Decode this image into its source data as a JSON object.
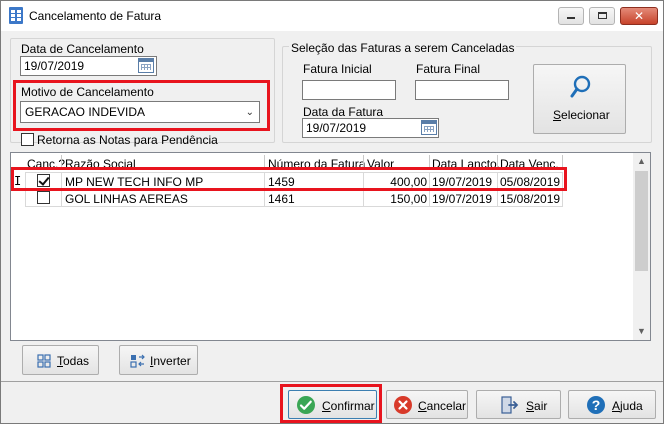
{
  "window": {
    "title": "Cancelamento de Fatura"
  },
  "form": {
    "data_cancelamento_label": "Data de Cancelamento",
    "data_cancelamento_value": "19/07/2019",
    "motivo_label": "Motivo de Cancelamento",
    "motivo_value": "GERACAO INDEVIDA",
    "retorna_label": "Retorna as Notas para Pendência",
    "retorna_checked": false
  },
  "selecao": {
    "group_label": "Seleção das Faturas a serem Canceladas",
    "fatura_inicial_label": "Fatura Inicial",
    "fatura_inicial_value": "",
    "fatura_final_label": "Fatura Final",
    "fatura_final_value": "",
    "data_fatura_label": "Data da Fatura",
    "data_fatura_value": "19/07/2019",
    "selecionar_label": "Selecionar"
  },
  "grid": {
    "columns": [
      "Canc.?",
      "Razão Social",
      "Número da Fatura",
      "Valor",
      "Data Lancto.",
      "Data Venc."
    ],
    "rows": [
      {
        "canc": true,
        "razao": "MP NEW TECH INFO MP",
        "numero": "1459",
        "valor": "400,00",
        "lancto": "19/07/2019",
        "venc": "05/08/2019"
      },
      {
        "canc": false,
        "razao": "GOL LINHAS AEREAS",
        "numero": "1461",
        "valor": "150,00",
        "lancto": "19/07/2019",
        "venc": "15/08/2019"
      }
    ]
  },
  "buttons": {
    "todos": "Todas",
    "inverter": "Inverter",
    "confirmar": "Confirmar",
    "cancelar": "Cancelar",
    "sair": "Sair",
    "ajuda": "Ajuda"
  },
  "colors": {
    "highlight": "#e8141e",
    "accent": "#1f6fb8",
    "confirm_green": "#3aa655",
    "cancel_red": "#d83a2a"
  }
}
